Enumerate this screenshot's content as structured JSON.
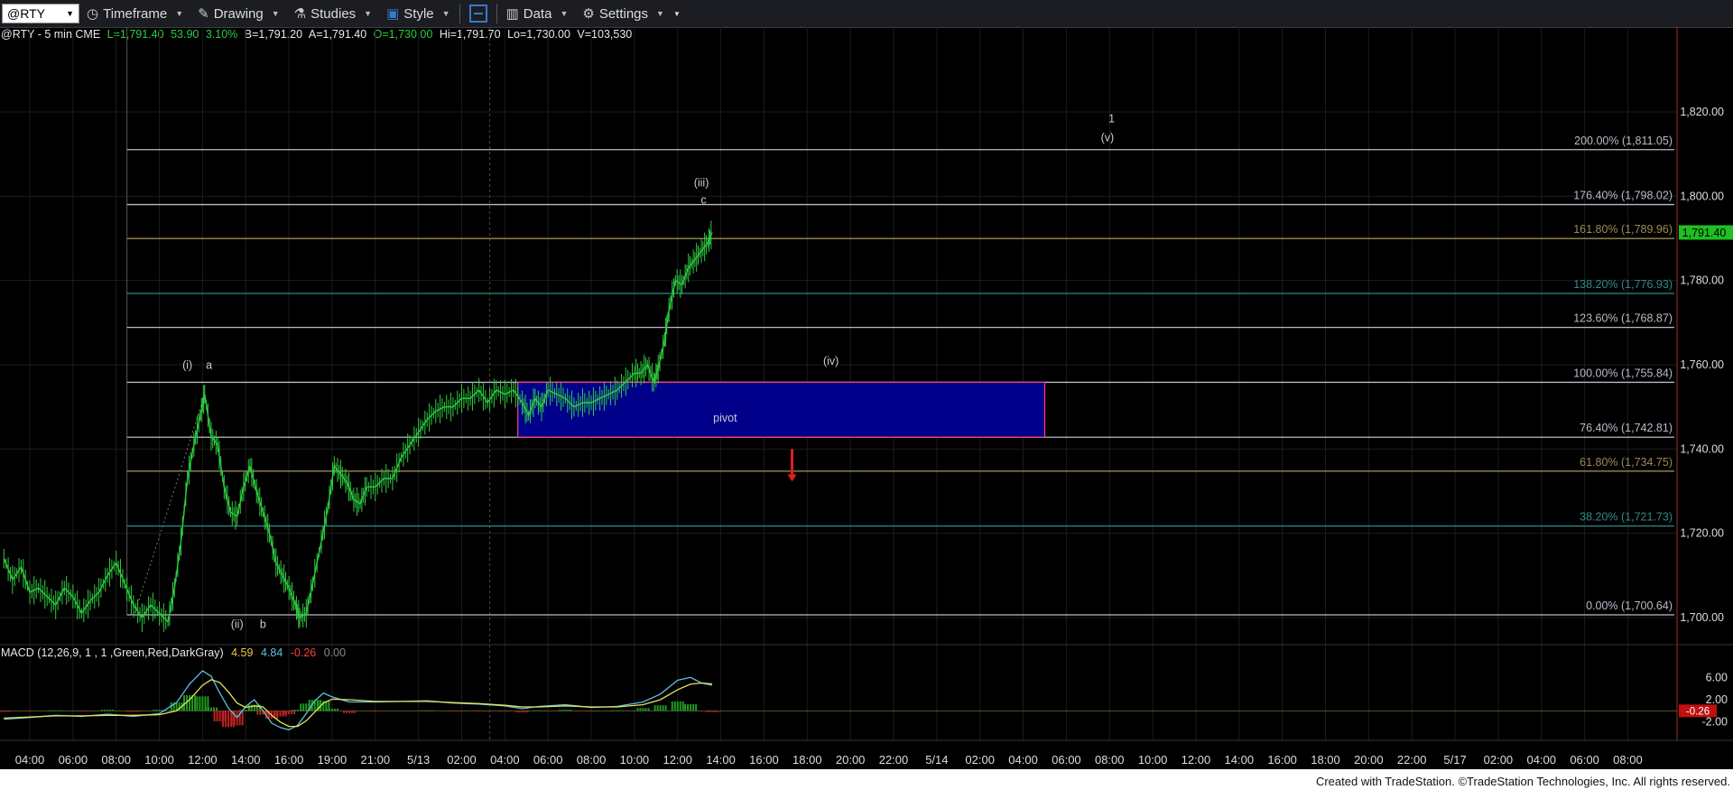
{
  "toolbar": {
    "symbol": "@RTY",
    "timeframe": "Timeframe",
    "drawing": "Drawing",
    "studies": "Studies",
    "style": "Style",
    "data": "Data",
    "settings": "Settings"
  },
  "info": {
    "title": "@RTY - 5 min  CME",
    "last": "L=1,791.40",
    "change": "53.90",
    "pct": "3.10%",
    "bid": "B=1,791.20",
    "ask": "A=1,791.40",
    "open": "O=1,730.00",
    "high": "Hi=1,791.70",
    "low": "Lo=1,730.00",
    "volume": "V=103,530"
  },
  "macd": {
    "label": "MACD (12,26,9, 1 , 1 ,Green,Red,DarkGray)",
    "v1": "4.59",
    "v2": "4.84",
    "v3": "-0.26",
    "v4": "0.00"
  },
  "credit": "Created with TradeStation. ©TradeStation Technologies, Inc. All rights reserved.",
  "colors": {
    "price": "#2ecc40",
    "box": "#00008b",
    "box_border": "#ff4080",
    "last_tag": "#1fbf1f",
    "macd_line": "#5fc0e0",
    "signal_line": "#e8e060"
  },
  "chart_data": {
    "type": "line",
    "symbol": "@RTY",
    "interval": "5 min",
    "ylim": [
      1697,
      1830
    ],
    "y_ticks": [
      "1,820.00",
      "1,800.00",
      "1,780.00",
      "1,760.00",
      "1,740.00",
      "1,720.00",
      "1,700.00"
    ],
    "y_tick_values": [
      1820,
      1800,
      1780,
      1760,
      1740,
      1720,
      1700
    ],
    "x_labels": [
      "04:00",
      "06:00",
      "08:00",
      "10:00",
      "12:00",
      "14:00",
      "16:00",
      "19:00",
      "21:00",
      "5/13",
      "02:00",
      "04:00",
      "06:00",
      "08:00",
      "10:00",
      "12:00",
      "14:00",
      "16:00",
      "18:00",
      "20:00",
      "22:00",
      "5/14",
      "02:00",
      "04:00",
      "06:00",
      "08:00",
      "10:00",
      "12:00",
      "14:00",
      "16:00",
      "18:00",
      "20:00",
      "22:00",
      "5/17",
      "02:00",
      "04:00",
      "06:00",
      "08:00"
    ],
    "fib_levels": [
      {
        "label": "200.00% (1,811.05)",
        "value": 1811.05,
        "color": "#b8bcc8"
      },
      {
        "label": "176.40% (1,798.02)",
        "value": 1798.02,
        "color": "#b8bcc8"
      },
      {
        "label": "161.80% (1,789.96)",
        "value": 1789.96,
        "color": "#9a8a55"
      },
      {
        "label": "138.20% (1,776.93)",
        "value": 1776.93,
        "color": "#2f8a88"
      },
      {
        "label": "123.60% (1,768.87)",
        "value": 1768.87,
        "color": "#b8bcc8"
      },
      {
        "label": "100.00% (1,755.84)",
        "value": 1755.84,
        "color": "#b8bcc8"
      },
      {
        "label": "76.40% (1,742.81)",
        "value": 1742.81,
        "color": "#b8bcc8"
      },
      {
        "label": "61.80% (1,734.75)",
        "value": 1734.75,
        "color": "#9a8a55"
      },
      {
        "label": "38.20% (1,721.73)",
        "value": 1721.73,
        "color": "#2f8a88"
      },
      {
        "label": "0.00% (1,700.64)",
        "value": 1700.64,
        "color": "#b8bcc8"
      }
    ],
    "last_price": "1,791.40",
    "last_value": 1791.4,
    "pivot_zone": {
      "label": "pivot",
      "from_index": 11.3,
      "to_index": 23.5,
      "low": 1742.81,
      "high": 1755.84
    },
    "wave_labels": [
      {
        "text": "(i)",
        "index": 3.65,
        "value": 1759
      },
      {
        "text": "a",
        "index": 4.15,
        "value": 1759
      },
      {
        "text": "(ii)",
        "index": 4.8,
        "value": 1697.5
      },
      {
        "text": "b",
        "index": 5.4,
        "value": 1697.5
      },
      {
        "text": "(iii)",
        "index": 15.55,
        "value": 1802.3
      },
      {
        "text": "c",
        "index": 15.6,
        "value": 1798.2
      },
      {
        "text": "(iv)",
        "index": 18.55,
        "value": 1760
      },
      {
        "text": "1",
        "index": 25.05,
        "value": 1817.5
      },
      {
        "text": "(v)",
        "index": 24.95,
        "value": 1813
      },
      {
        "text": "pivot",
        "index": 16.1,
        "value": 1746.5
      }
    ],
    "down_arrow": {
      "index": 17.65,
      "value_top": 1740,
      "value_bottom": 1734
    },
    "price_path": [
      [
        -0.6,
        1714
      ],
      [
        -0.4,
        1709
      ],
      [
        -0.2,
        1712
      ],
      [
        0,
        1706
      ],
      [
        0.2,
        1707
      ],
      [
        0.4,
        1705
      ],
      [
        0.6,
        1703
      ],
      [
        0.8,
        1707
      ],
      [
        1.0,
        1705
      ],
      [
        1.2,
        1701
      ],
      [
        1.4,
        1704
      ],
      [
        1.6,
        1706
      ],
      [
        1.8,
        1710
      ],
      [
        2.0,
        1713
      ],
      [
        2.2,
        1708
      ],
      [
        2.4,
        1703
      ],
      [
        2.6,
        1700
      ],
      [
        2.8,
        1703
      ],
      [
        3.0,
        1701
      ],
      [
        3.2,
        1699
      ],
      [
        3.35,
        1707
      ],
      [
        3.5,
        1718
      ],
      [
        3.65,
        1733
      ],
      [
        3.8,
        1741
      ],
      [
        3.95,
        1748
      ],
      [
        4.05,
        1753
      ],
      [
        4.2,
        1743
      ],
      [
        4.35,
        1741
      ],
      [
        4.5,
        1731
      ],
      [
        4.65,
        1725
      ],
      [
        4.8,
        1724
      ],
      [
        4.95,
        1731
      ],
      [
        5.1,
        1736
      ],
      [
        5.25,
        1730
      ],
      [
        5.4,
        1725
      ],
      [
        5.55,
        1720
      ],
      [
        5.7,
        1713
      ],
      [
        5.85,
        1710
      ],
      [
        6.0,
        1707
      ],
      [
        6.15,
        1703
      ],
      [
        6.25,
        1700
      ],
      [
        6.4,
        1701
      ],
      [
        6.55,
        1708
      ],
      [
        6.75,
        1718
      ],
      [
        6.9,
        1726
      ],
      [
        7.05,
        1736
      ],
      [
        7.2,
        1734
      ],
      [
        7.35,
        1732
      ],
      [
        7.5,
        1728
      ],
      [
        7.65,
        1727
      ],
      [
        7.8,
        1731
      ],
      [
        8.0,
        1731
      ],
      [
        8.2,
        1733
      ],
      [
        8.4,
        1733
      ],
      [
        8.6,
        1738
      ],
      [
        8.8,
        1741
      ],
      [
        9.0,
        1744
      ],
      [
        9.2,
        1747
      ],
      [
        9.4,
        1749
      ],
      [
        9.6,
        1750
      ],
      [
        9.8,
        1750
      ],
      [
        10.0,
        1752
      ],
      [
        10.2,
        1752
      ],
      [
        10.4,
        1754
      ],
      [
        10.6,
        1751
      ],
      [
        10.8,
        1754
      ],
      [
        11.0,
        1753
      ],
      [
        11.2,
        1754
      ],
      [
        11.4,
        1751
      ],
      [
        11.55,
        1748
      ],
      [
        11.7,
        1752
      ],
      [
        11.85,
        1750
      ],
      [
        12.0,
        1754
      ],
      [
        12.2,
        1753
      ],
      [
        12.4,
        1752
      ],
      [
        12.6,
        1750
      ],
      [
        12.8,
        1751
      ],
      [
        13.0,
        1751
      ],
      [
        13.2,
        1752
      ],
      [
        13.4,
        1753
      ],
      [
        13.6,
        1754
      ],
      [
        13.8,
        1756
      ],
      [
        14.0,
        1758
      ],
      [
        14.15,
        1758
      ],
      [
        14.3,
        1760
      ],
      [
        14.45,
        1756
      ],
      [
        14.55,
        1759
      ],
      [
        14.7,
        1766
      ],
      [
        14.8,
        1773
      ],
      [
        14.95,
        1780
      ],
      [
        15.1,
        1779
      ],
      [
        15.25,
        1783
      ],
      [
        15.4,
        1785
      ],
      [
        15.55,
        1787
      ],
      [
        15.7,
        1789
      ],
      [
        15.8,
        1791.4
      ]
    ],
    "macd_line": [
      [
        -0.6,
        -1.5
      ],
      [
        0,
        -1.2
      ],
      [
        0.6,
        -0.8
      ],
      [
        1.2,
        -1.0
      ],
      [
        1.8,
        -0.6
      ],
      [
        2.4,
        -1.0
      ],
      [
        3.0,
        -0.5
      ],
      [
        3.4,
        1.5
      ],
      [
        3.7,
        4.8
      ],
      [
        4.0,
        7.2
      ],
      [
        4.2,
        6.2
      ],
      [
        4.4,
        3.2
      ],
      [
        4.6,
        0.5
      ],
      [
        4.8,
        -1.2
      ],
      [
        5.0,
        0.8
      ],
      [
        5.2,
        2.0
      ],
      [
        5.4,
        0.0
      ],
      [
        5.6,
        -2.2
      ],
      [
        5.8,
        -3.0
      ],
      [
        6.0,
        -3.4
      ],
      [
        6.2,
        -2.6
      ],
      [
        6.4,
        -0.5
      ],
      [
        6.6,
        1.8
      ],
      [
        6.8,
        3.2
      ],
      [
        7.0,
        2.5
      ],
      [
        7.4,
        1.6
      ],
      [
        8.0,
        1.6
      ],
      [
        8.6,
        1.7
      ],
      [
        9.2,
        1.8
      ],
      [
        9.8,
        1.4
      ],
      [
        10.4,
        1.2
      ],
      [
        11.0,
        0.9
      ],
      [
        11.4,
        0.4
      ],
      [
        11.8,
        0.8
      ],
      [
        12.4,
        1.1
      ],
      [
        13.0,
        0.6
      ],
      [
        13.6,
        0.8
      ],
      [
        14.2,
        1.6
      ],
      [
        14.6,
        3.0
      ],
      [
        15.0,
        5.5
      ],
      [
        15.3,
        6.0
      ],
      [
        15.55,
        5.0
      ],
      [
        15.8,
        4.6
      ]
    ],
    "signal_line": [
      [
        -0.6,
        -1.3
      ],
      [
        0,
        -1.1
      ],
      [
        0.6,
        -0.9
      ],
      [
        1.2,
        -0.9
      ],
      [
        1.8,
        -0.8
      ],
      [
        2.4,
        -0.8
      ],
      [
        3.0,
        -0.7
      ],
      [
        3.4,
        0.0
      ],
      [
        3.7,
        2.0
      ],
      [
        4.0,
        4.6
      ],
      [
        4.2,
        5.6
      ],
      [
        4.4,
        5.1
      ],
      [
        4.6,
        3.4
      ],
      [
        4.8,
        1.4
      ],
      [
        5.0,
        0.6
      ],
      [
        5.2,
        0.9
      ],
      [
        5.4,
        0.7
      ],
      [
        5.6,
        -0.8
      ],
      [
        5.8,
        -2.0
      ],
      [
        6.0,
        -2.8
      ],
      [
        6.2,
        -2.8
      ],
      [
        6.4,
        -1.8
      ],
      [
        6.6,
        -0.2
      ],
      [
        6.8,
        1.4
      ],
      [
        7.0,
        2.1
      ],
      [
        7.4,
        2.0
      ],
      [
        8.0,
        1.7
      ],
      [
        8.6,
        1.7
      ],
      [
        9.2,
        1.7
      ],
      [
        9.8,
        1.5
      ],
      [
        10.4,
        1.3
      ],
      [
        11.0,
        1.0
      ],
      [
        11.4,
        0.7
      ],
      [
        11.8,
        0.7
      ],
      [
        12.4,
        0.9
      ],
      [
        13.0,
        0.7
      ],
      [
        13.6,
        0.7
      ],
      [
        14.2,
        1.1
      ],
      [
        14.6,
        2.0
      ],
      [
        15.0,
        3.8
      ],
      [
        15.3,
        4.8
      ],
      [
        15.55,
        5.0
      ],
      [
        15.8,
        4.84
      ]
    ],
    "macd_axis": {
      "ylim": [
        -4.0,
        8.0
      ],
      "ticks": [
        "6.00",
        "2.00",
        "-2.00"
      ],
      "tick_values": [
        6,
        2,
        -2
      ],
      "tag": "-0.26",
      "tag_value": 0
    }
  }
}
